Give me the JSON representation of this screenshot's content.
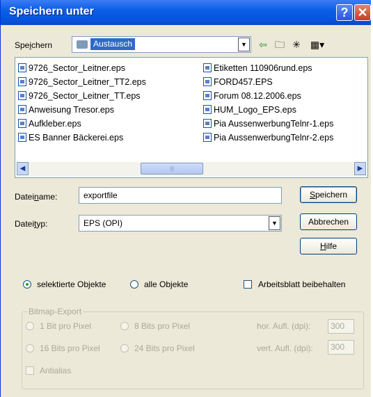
{
  "window": {
    "title": "Speichern unter"
  },
  "save_in": {
    "label": "Speichern",
    "folder": "Austausch"
  },
  "files_left": [
    "9726_Sector_Leitner.eps",
    "9726_Sector_Leitner_TT2.eps",
    "9726_Sector_Leitner_TT.eps",
    "Anweisung Tresor.eps",
    "Aufkleber.eps",
    "ES Banner Bäckerei.eps"
  ],
  "files_right": [
    "Etiketten 110906rund.eps",
    "FORD457.EPS",
    "Forum 08.12.2006.eps",
    "HUM_Logo_EPS.eps",
    "Pia AussenwerbungTelnr-1.eps",
    "Pia AussenwerbungTelnr-2.eps"
  ],
  "filename": {
    "label": "Dateiname:",
    "value": "exportfile"
  },
  "filetype": {
    "label": "Dateityp:",
    "value": "EPS (OPI)"
  },
  "buttons": {
    "save": "Speichern",
    "cancel": "Abbrechen",
    "help": "Hilfe"
  },
  "options": {
    "selected": "selektierte Objekte",
    "all": "alle Objekte",
    "keep_sheet": "Arbeitsblatt beibehalten"
  },
  "bitmap": {
    "title": "Bitmap-Export",
    "bit1": "1 Bit pro Pixel",
    "bit8": "8 Bits pro Pixel",
    "bit16": "16 Bits pro Pixel",
    "bit24": "24 Bits pro Pixel",
    "hor_label": "hor. Aufl. (dpi):",
    "hor_value": "300",
    "vert_label": "vert. Aufl. (dpi):",
    "vert_value": "300",
    "antialias": "Antialias"
  }
}
